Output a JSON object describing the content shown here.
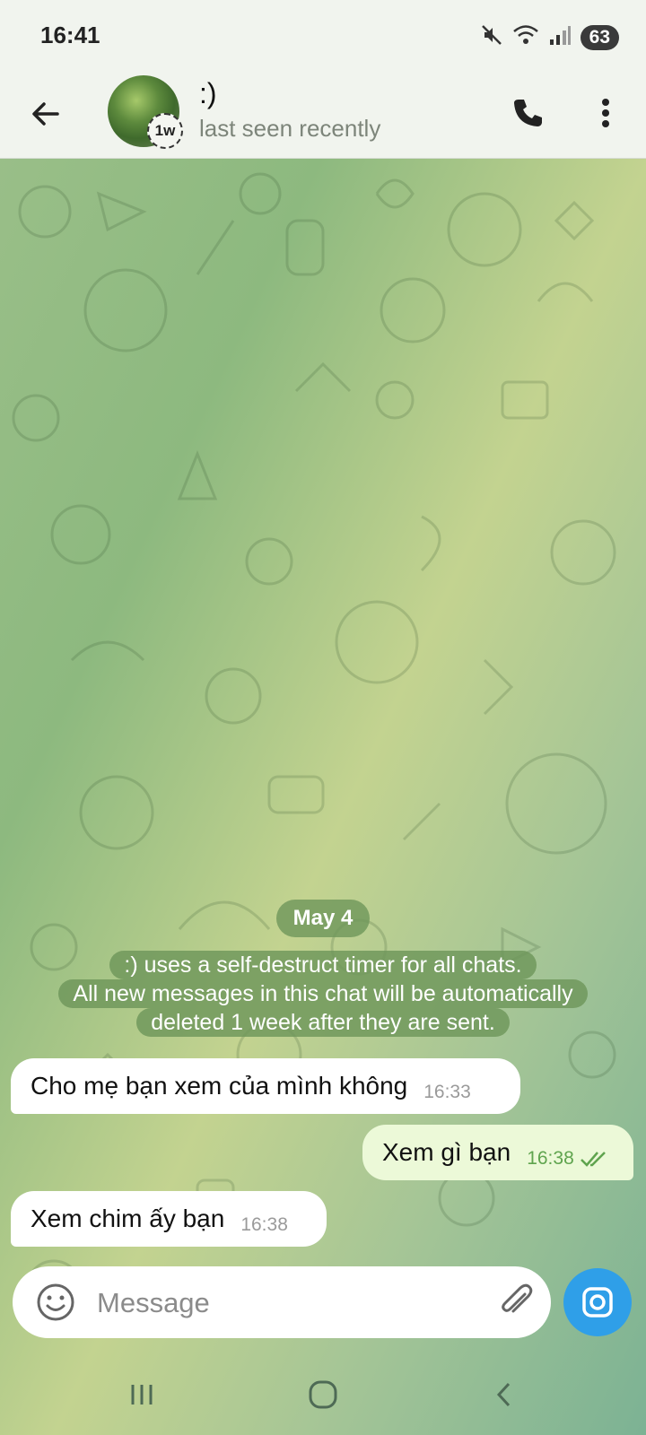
{
  "status_bar": {
    "time": "16:41",
    "battery": "63",
    "icons": [
      "mute-icon",
      "wifi-icon",
      "signal-icon",
      "battery-icon"
    ]
  },
  "header": {
    "chat_name": ":)",
    "chat_status": "last seen recently",
    "timer_badge": "1w"
  },
  "chat": {
    "date": "May 4",
    "service_lines": [
      ":) uses a self-destruct timer for all chats.",
      "All new messages in this chat will be automatically",
      "deleted 1 week after they are sent."
    ],
    "messages": [
      {
        "direction": "in",
        "text": "Cho mẹ bạn xem của mình không",
        "time": "16:33"
      },
      {
        "direction": "out",
        "text": "Xem gì bạn",
        "time": "16:38",
        "read": true
      },
      {
        "direction": "in",
        "text": "Xem chim ấy bạn",
        "time": "16:38"
      }
    ]
  },
  "input": {
    "placeholder": "Message"
  },
  "colors": {
    "accent": "#2f9fe8",
    "outgoing_bubble": "#ecf9d8",
    "incoming_bubble": "#ffffff",
    "read_check": "#5fa44e"
  }
}
